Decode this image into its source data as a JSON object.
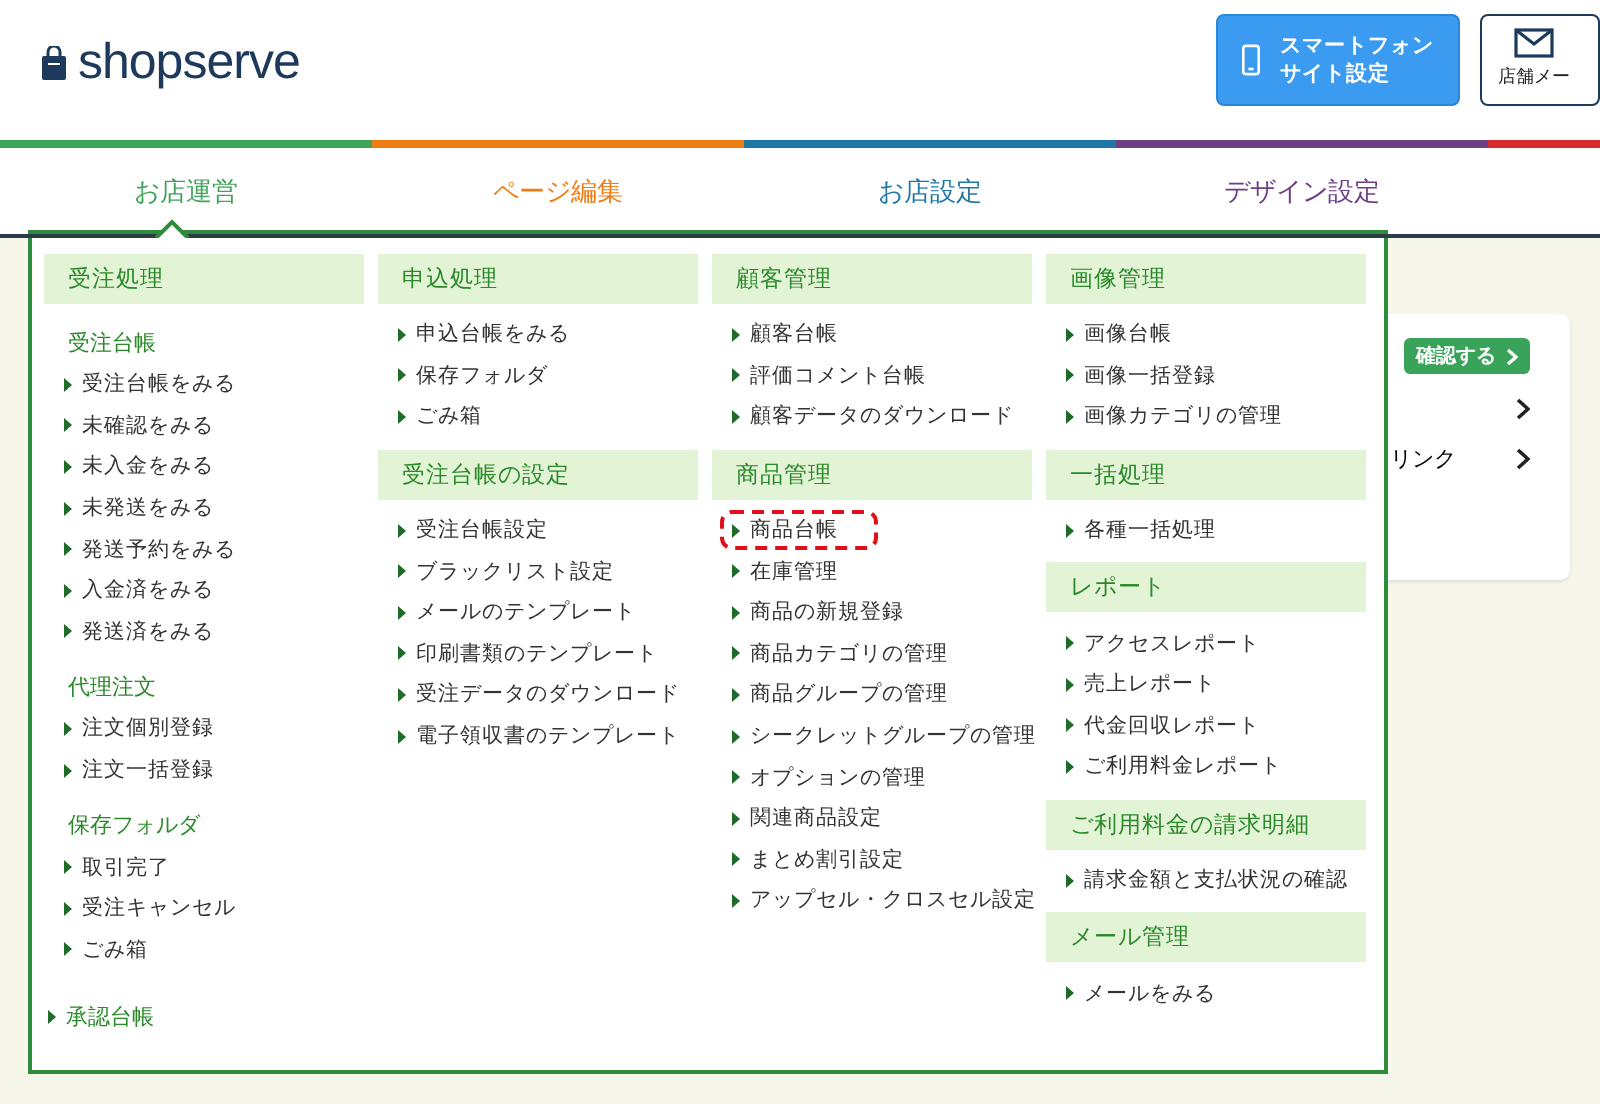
{
  "header": {
    "logo": "shopserve",
    "buttons": [
      {
        "kind": "phone",
        "lines": [
          "スマートフォン",
          "サイト設定"
        ]
      },
      {
        "kind": "mail",
        "label": "店舗メー"
      }
    ]
  },
  "nav": {
    "tabs": [
      {
        "label": "お店運営",
        "color": "#3fa35a",
        "selected": true
      },
      {
        "label": "ページ編集",
        "color": "#f07d14",
        "selected": false
      },
      {
        "label": "お店設定",
        "color": "#1f77a8",
        "selected": false
      },
      {
        "label": "デザイン設定",
        "color": "#6b3f86",
        "selected": false
      }
    ]
  },
  "background_card": {
    "button": "確認する",
    "rows": [
      "",
      "リンク"
    ]
  },
  "menu": {
    "columns": [
      [
        {
          "kind": "header",
          "label": "受注処理"
        },
        {
          "kind": "subhead",
          "label": "受注台帳"
        },
        {
          "kind": "item",
          "label": "受注台帳をみる",
          "highlighted": false
        },
        {
          "kind": "item",
          "label": "未確認をみる",
          "highlighted": false
        },
        {
          "kind": "item",
          "label": "未入金をみる",
          "highlighted": false
        },
        {
          "kind": "item",
          "label": "未発送をみる",
          "highlighted": false
        },
        {
          "kind": "item",
          "label": "発送予約をみる",
          "highlighted": false
        },
        {
          "kind": "item",
          "label": "入金済をみる",
          "highlighted": false
        },
        {
          "kind": "item",
          "label": "発送済をみる",
          "highlighted": false
        },
        {
          "kind": "subhead",
          "label": "代理注文"
        },
        {
          "kind": "item",
          "label": "注文個別登録",
          "highlighted": false
        },
        {
          "kind": "item",
          "label": "注文一括登録",
          "highlighted": false
        },
        {
          "kind": "subhead",
          "label": "保存フォルダ"
        },
        {
          "kind": "item",
          "label": "取引完了",
          "highlighted": false
        },
        {
          "kind": "item",
          "label": "受注キャンセル",
          "highlighted": false
        },
        {
          "kind": "item",
          "label": "ごみ箱",
          "highlighted": false
        },
        {
          "kind": "link",
          "label": "承認台帳"
        }
      ],
      [
        {
          "kind": "header",
          "label": "申込処理"
        },
        {
          "kind": "item",
          "label": "申込台帳をみる",
          "highlighted": false
        },
        {
          "kind": "item",
          "label": "保存フォルダ",
          "highlighted": false
        },
        {
          "kind": "item",
          "label": "ごみ箱",
          "highlighted": false
        },
        {
          "kind": "header",
          "label": "受注台帳の設定"
        },
        {
          "kind": "item",
          "label": "受注台帳設定",
          "highlighted": false
        },
        {
          "kind": "item",
          "label": "ブラックリスト設定",
          "highlighted": false
        },
        {
          "kind": "item",
          "label": "メールのテンプレート",
          "highlighted": false
        },
        {
          "kind": "item",
          "label": "印刷書類のテンプレート",
          "highlighted": false
        },
        {
          "kind": "item",
          "label": "受注データのダウンロード",
          "highlighted": false
        },
        {
          "kind": "item",
          "label": "電子領収書のテンプレート",
          "highlighted": false
        }
      ],
      [
        {
          "kind": "header",
          "label": "顧客管理"
        },
        {
          "kind": "item",
          "label": "顧客台帳",
          "highlighted": false
        },
        {
          "kind": "item",
          "label": "評価コメント台帳",
          "highlighted": false
        },
        {
          "kind": "item",
          "label": "顧客データのダウンロード",
          "highlighted": false
        },
        {
          "kind": "header",
          "label": "商品管理"
        },
        {
          "kind": "item",
          "label": "商品台帳",
          "highlighted": true
        },
        {
          "kind": "item",
          "label": "在庫管理",
          "highlighted": false
        },
        {
          "kind": "item",
          "label": "商品の新規登録",
          "highlighted": false
        },
        {
          "kind": "item",
          "label": "商品カテゴリの管理",
          "highlighted": false
        },
        {
          "kind": "item",
          "label": "商品グループの管理",
          "highlighted": false
        },
        {
          "kind": "item",
          "label": "シークレットグループの管理",
          "highlighted": false
        },
        {
          "kind": "item",
          "label": "オプションの管理",
          "highlighted": false
        },
        {
          "kind": "item",
          "label": "関連商品設定",
          "highlighted": false
        },
        {
          "kind": "item",
          "label": "まとめ割引設定",
          "highlighted": false
        },
        {
          "kind": "item",
          "label": "アップセル・クロスセル設定",
          "highlighted": false
        }
      ],
      [
        {
          "kind": "header",
          "label": "画像管理"
        },
        {
          "kind": "item",
          "label": "画像台帳",
          "highlighted": false
        },
        {
          "kind": "item",
          "label": "画像一括登録",
          "highlighted": false
        },
        {
          "kind": "item",
          "label": "画像カテゴリの管理",
          "highlighted": false
        },
        {
          "kind": "header",
          "label": "一括処理"
        },
        {
          "kind": "item",
          "label": "各種一括処理",
          "highlighted": false
        },
        {
          "kind": "header",
          "label": "レポート"
        },
        {
          "kind": "item",
          "label": "アクセスレポート",
          "highlighted": false
        },
        {
          "kind": "item",
          "label": "売上レポート",
          "highlighted": false
        },
        {
          "kind": "item",
          "label": "代金回収レポート",
          "highlighted": false
        },
        {
          "kind": "item",
          "label": "ご利用料金レポート",
          "highlighted": false
        },
        {
          "kind": "header",
          "label": "ご利用料金の請求明細"
        },
        {
          "kind": "item",
          "label": "請求金額と支払状況の確認",
          "highlighted": false
        },
        {
          "kind": "header",
          "label": "メール管理"
        },
        {
          "kind": "item",
          "label": "メールをみる",
          "highlighted": false
        }
      ]
    ]
  }
}
